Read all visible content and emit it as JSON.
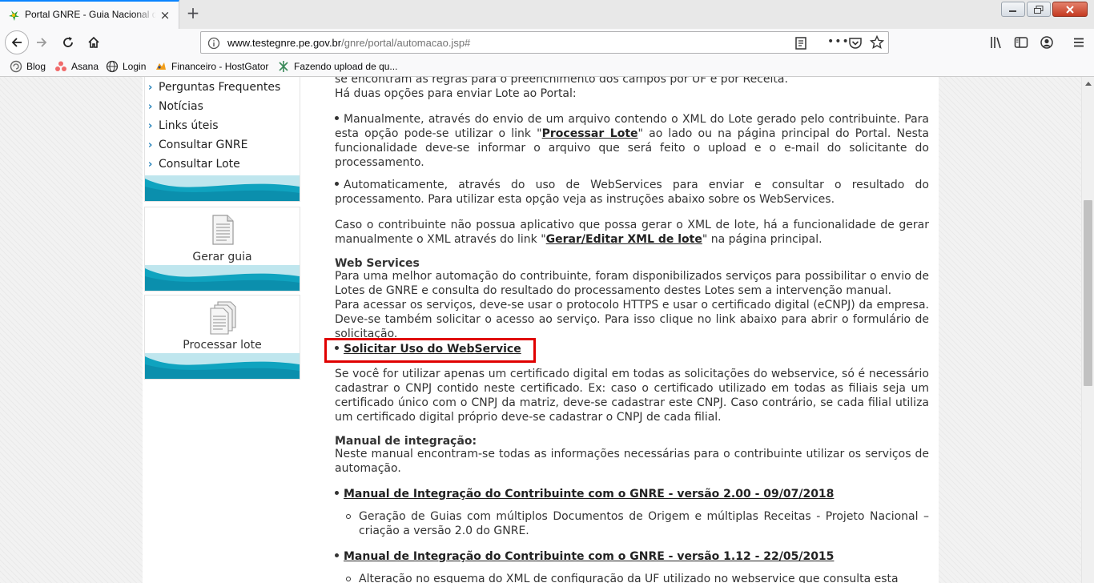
{
  "browser": {
    "tab_title": "Portal GNRE - Guia Nacional de Recolhimento",
    "new_tab_symbol": "+",
    "close_symbol": "×",
    "url_host": "www.testegnre.pe.gov.br",
    "url_path": "/gnre/portal/automacao.jsp#",
    "page_actions_symbol": "•••",
    "bookmarks": [
      "Blog",
      "Asana",
      "Login",
      "Financeiro - HostGator",
      "Fazendo upload de qu..."
    ]
  },
  "sidebar": {
    "chevron": "›",
    "menu": [
      "Perguntas Frequentes",
      "Notícias",
      "Links úteis",
      "Consultar GNRE",
      "Consultar Lote"
    ],
    "cards": [
      {
        "label": "Gerar guia",
        "icon": "document-icon"
      },
      {
        "label": "Processar lote",
        "icon": "documents-stack-icon"
      }
    ]
  },
  "content": {
    "intro_cut": "se encontram as regras para o preenchimento dos campos por UF e por Receita.",
    "intro": "Há duas opções para enviar Lote ao Portal:",
    "manual_option": {
      "before": "Manualmente, através do envio de um arquivo contendo o XML do Lote gerado pelo contribuinte. Para esta opção pode-se utilizar o link \"",
      "link": "Processar Lote",
      "after": "\" ao lado ou na página principal do Portal. Nesta funcionalidade deve-se informar o arquivo que será feito o upload e o e-mail do solicitante do processamento."
    },
    "auto_option": "Automaticamente, através do uso de WebServices para enviar e consultar o resultado do processamento. Para utilizar esta opção veja as instruções abaixo sobre os WebServices.",
    "no_app": {
      "before": "Caso o contribuinte não possua aplicativo que possa gerar o XML de lote, há a funcionalidade de gerar manualmente o XML através do link \"",
      "link": "Gerar/Editar XML de lote",
      "after": "\" na página principal."
    },
    "ws_heading": "Web Services",
    "ws_text1": "Para uma melhor automação do contribuinte, foram disponibilizados serviços para possibilitar o envio de Lotes de GNRE e consulta do resultado do processamento destes Lotes sem a intervenção manual.",
    "ws_text2": "Para acessar os serviços, deve-se usar o protocolo HTTPS e usar o certificado digital (eCNPJ) da empresa. Deve-se também solicitar o acesso ao serviço. Para isso clique no link abaixo para abrir o formulário de solicitação.",
    "ws_link": "Solicitar Uso do WebService",
    "cert_text": "Se você for utilizar apenas um certificado digital em todas as solicitações do webservice, só é necessário cadastrar o CNPJ contido neste certificado. Ex: caso o certificado utilizado em todas as filiais seja um certificado único com o CNPJ da matriz, deve-se cadastrar este CNPJ. Caso contrário, se cada filial utiliza um certificado digital próprio deve-se cadastrar o CNPJ de cada filial.",
    "manual_heading": "Manual de integração:",
    "manual_text": "Neste manual encontram-se todas as informações necessárias para o contribuinte utilizar os serviços de automação.",
    "manuals": [
      {
        "link": "Manual de Integração do Contribuinte com o GNRE - versão 2.00 - 09/07/2018",
        "desc": "Geração de Guias com múltiplos Documentos de Origem e múltiplas Receitas - Projeto Nacional – criação a versão 2.0 do GNRE."
      },
      {
        "link": "Manual de Integração do Contribuinte com o GNRE - versão 1.12 - 22/05/2015",
        "desc": "Alteração no esquema do XML de configuração da UF utilizado no webservice que consulta esta"
      }
    ]
  },
  "colors": {
    "accent_blue": "#1f7fb8",
    "wave_teal": "#0fa3bf",
    "highlight_red": "#e00000",
    "tab_accent": "#0a84ff"
  }
}
